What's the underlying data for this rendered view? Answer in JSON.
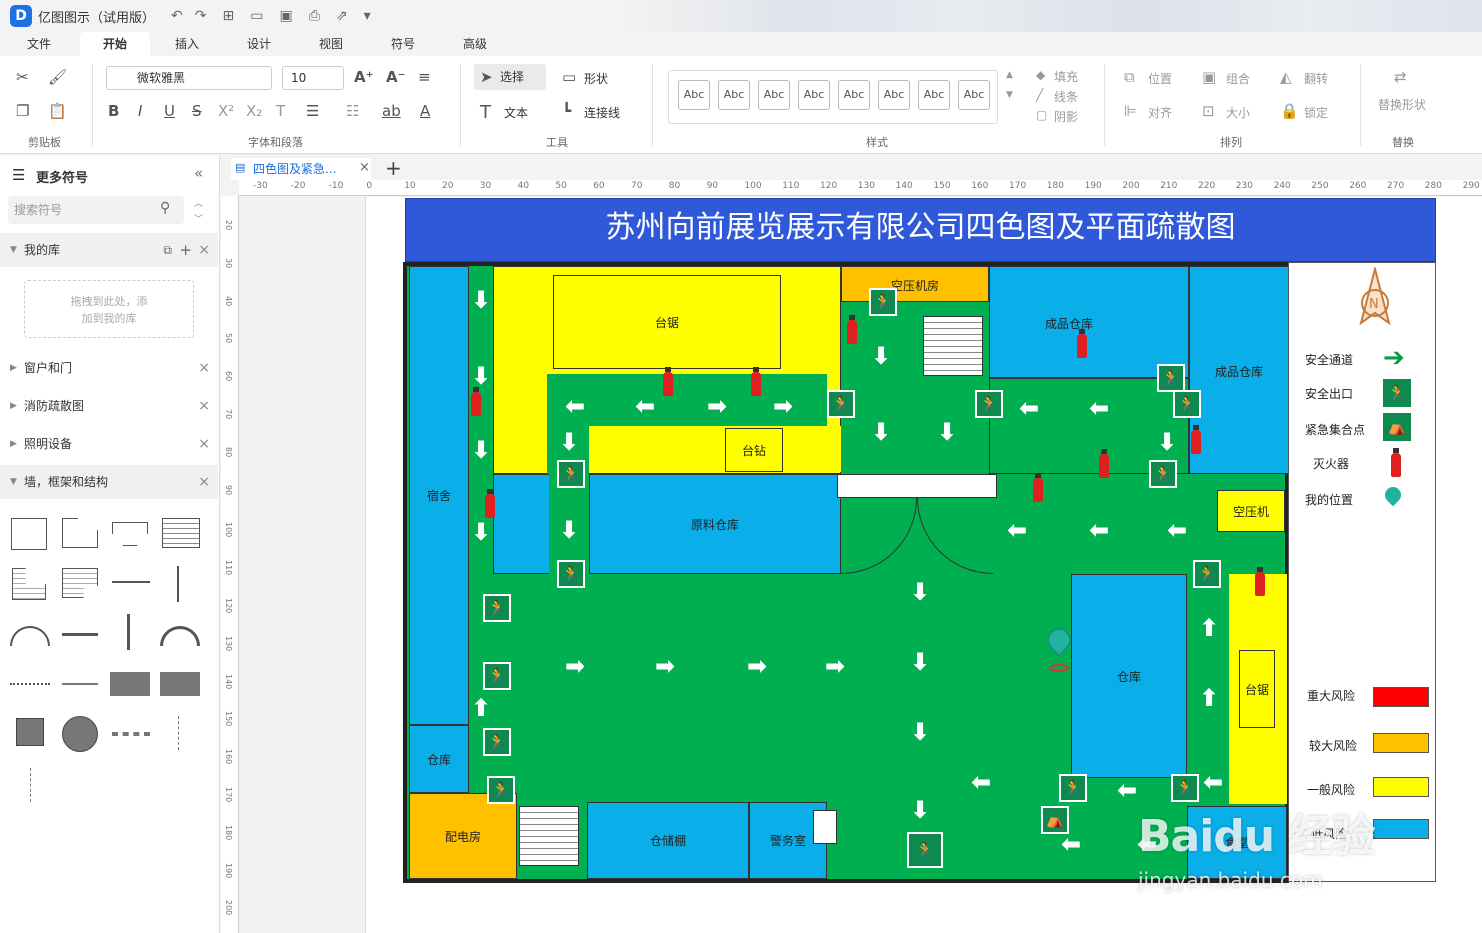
{
  "app": {
    "logo": "D",
    "title": "亿图图示（试用版）"
  },
  "menu": {
    "tabs": [
      "文件",
      "开始",
      "插入",
      "设计",
      "视图",
      "符号",
      "高级"
    ],
    "active": "开始"
  },
  "ribbon": {
    "groups": {
      "clipboard": "剪贴板",
      "font": "字体和段落",
      "tools": "工具",
      "styles": "样式",
      "arrange": "排列",
      "replace": "替换"
    },
    "font_name": "微软雅黑",
    "font_size": "10",
    "select_label": "选择",
    "shape_label": "形状",
    "text_label": "文本",
    "connector_label": "连接线",
    "style_sample": "Abc",
    "fill_label": "填充",
    "line_label": "线条",
    "shadow_label": "阴影",
    "position_label": "位置",
    "group_label": "组合",
    "flip_label": "翻转",
    "align_label": "对齐",
    "size_label": "大小",
    "lock_label": "锁定",
    "replace_shape_label": "替换形状"
  },
  "left_panel": {
    "title": "更多符号",
    "search_placeholder": "搜索符号",
    "my_library": "我的库",
    "drop_hint_1": "拖拽到此处，添",
    "drop_hint_2": "加到我的库",
    "libraries": [
      "窗户和门",
      "消防疏散图",
      "照明设备",
      "墙，框架和结构"
    ]
  },
  "document": {
    "tab_label": "四色图及紧急..."
  },
  "ruler": {
    "h_ticks": [
      "-30",
      "-20",
      "-10",
      "0",
      "10",
      "20",
      "30",
      "40",
      "50",
      "60",
      "70",
      "80",
      "90",
      "100",
      "110",
      "120",
      "130",
      "140",
      "150",
      "160",
      "170",
      "180",
      "190",
      "200",
      "210",
      "220",
      "230",
      "240",
      "250",
      "260",
      "270",
      "280",
      "290"
    ],
    "v_ticks": [
      "20",
      "30",
      "40",
      "50",
      "60",
      "70",
      "80",
      "90",
      "100",
      "110",
      "120",
      "130",
      "140",
      "150",
      "160",
      "170",
      "180",
      "190",
      "200"
    ]
  },
  "floorplan": {
    "title": "苏州向前展览展示有限公司四色图及平面疏散图",
    "rooms": {
      "saw1": "台锯",
      "compressor_room": "空压机房",
      "finished1": "成品仓库",
      "finished2": "成品仓库",
      "drill": "台钻",
      "dorm": "宿舍",
      "raw": "原料仓库",
      "compressor": "空压机",
      "warehouse1": "仓库",
      "warehouse2": "仓库",
      "saw2": "台锯",
      "power": "配电房",
      "storage_shed": "仓储棚",
      "guard": "警务室",
      "cafeteria": "食堂"
    },
    "north": "N"
  },
  "legend": {
    "items": [
      "安全通道",
      "安全出口",
      "紧急集合点",
      "灭火器",
      "我的位置"
    ],
    "risks": [
      {
        "label": "重大风险",
        "color": "#ff0000"
      },
      {
        "label": "较大风险",
        "color": "#ffc000"
      },
      {
        "label": "一般风险",
        "color": "#ffff00"
      },
      {
        "label": "低风险",
        "color": "#0aaee8"
      }
    ]
  },
  "watermark": {
    "brand": "Baidu 经验",
    "url": "jingyan.baidu.com"
  }
}
